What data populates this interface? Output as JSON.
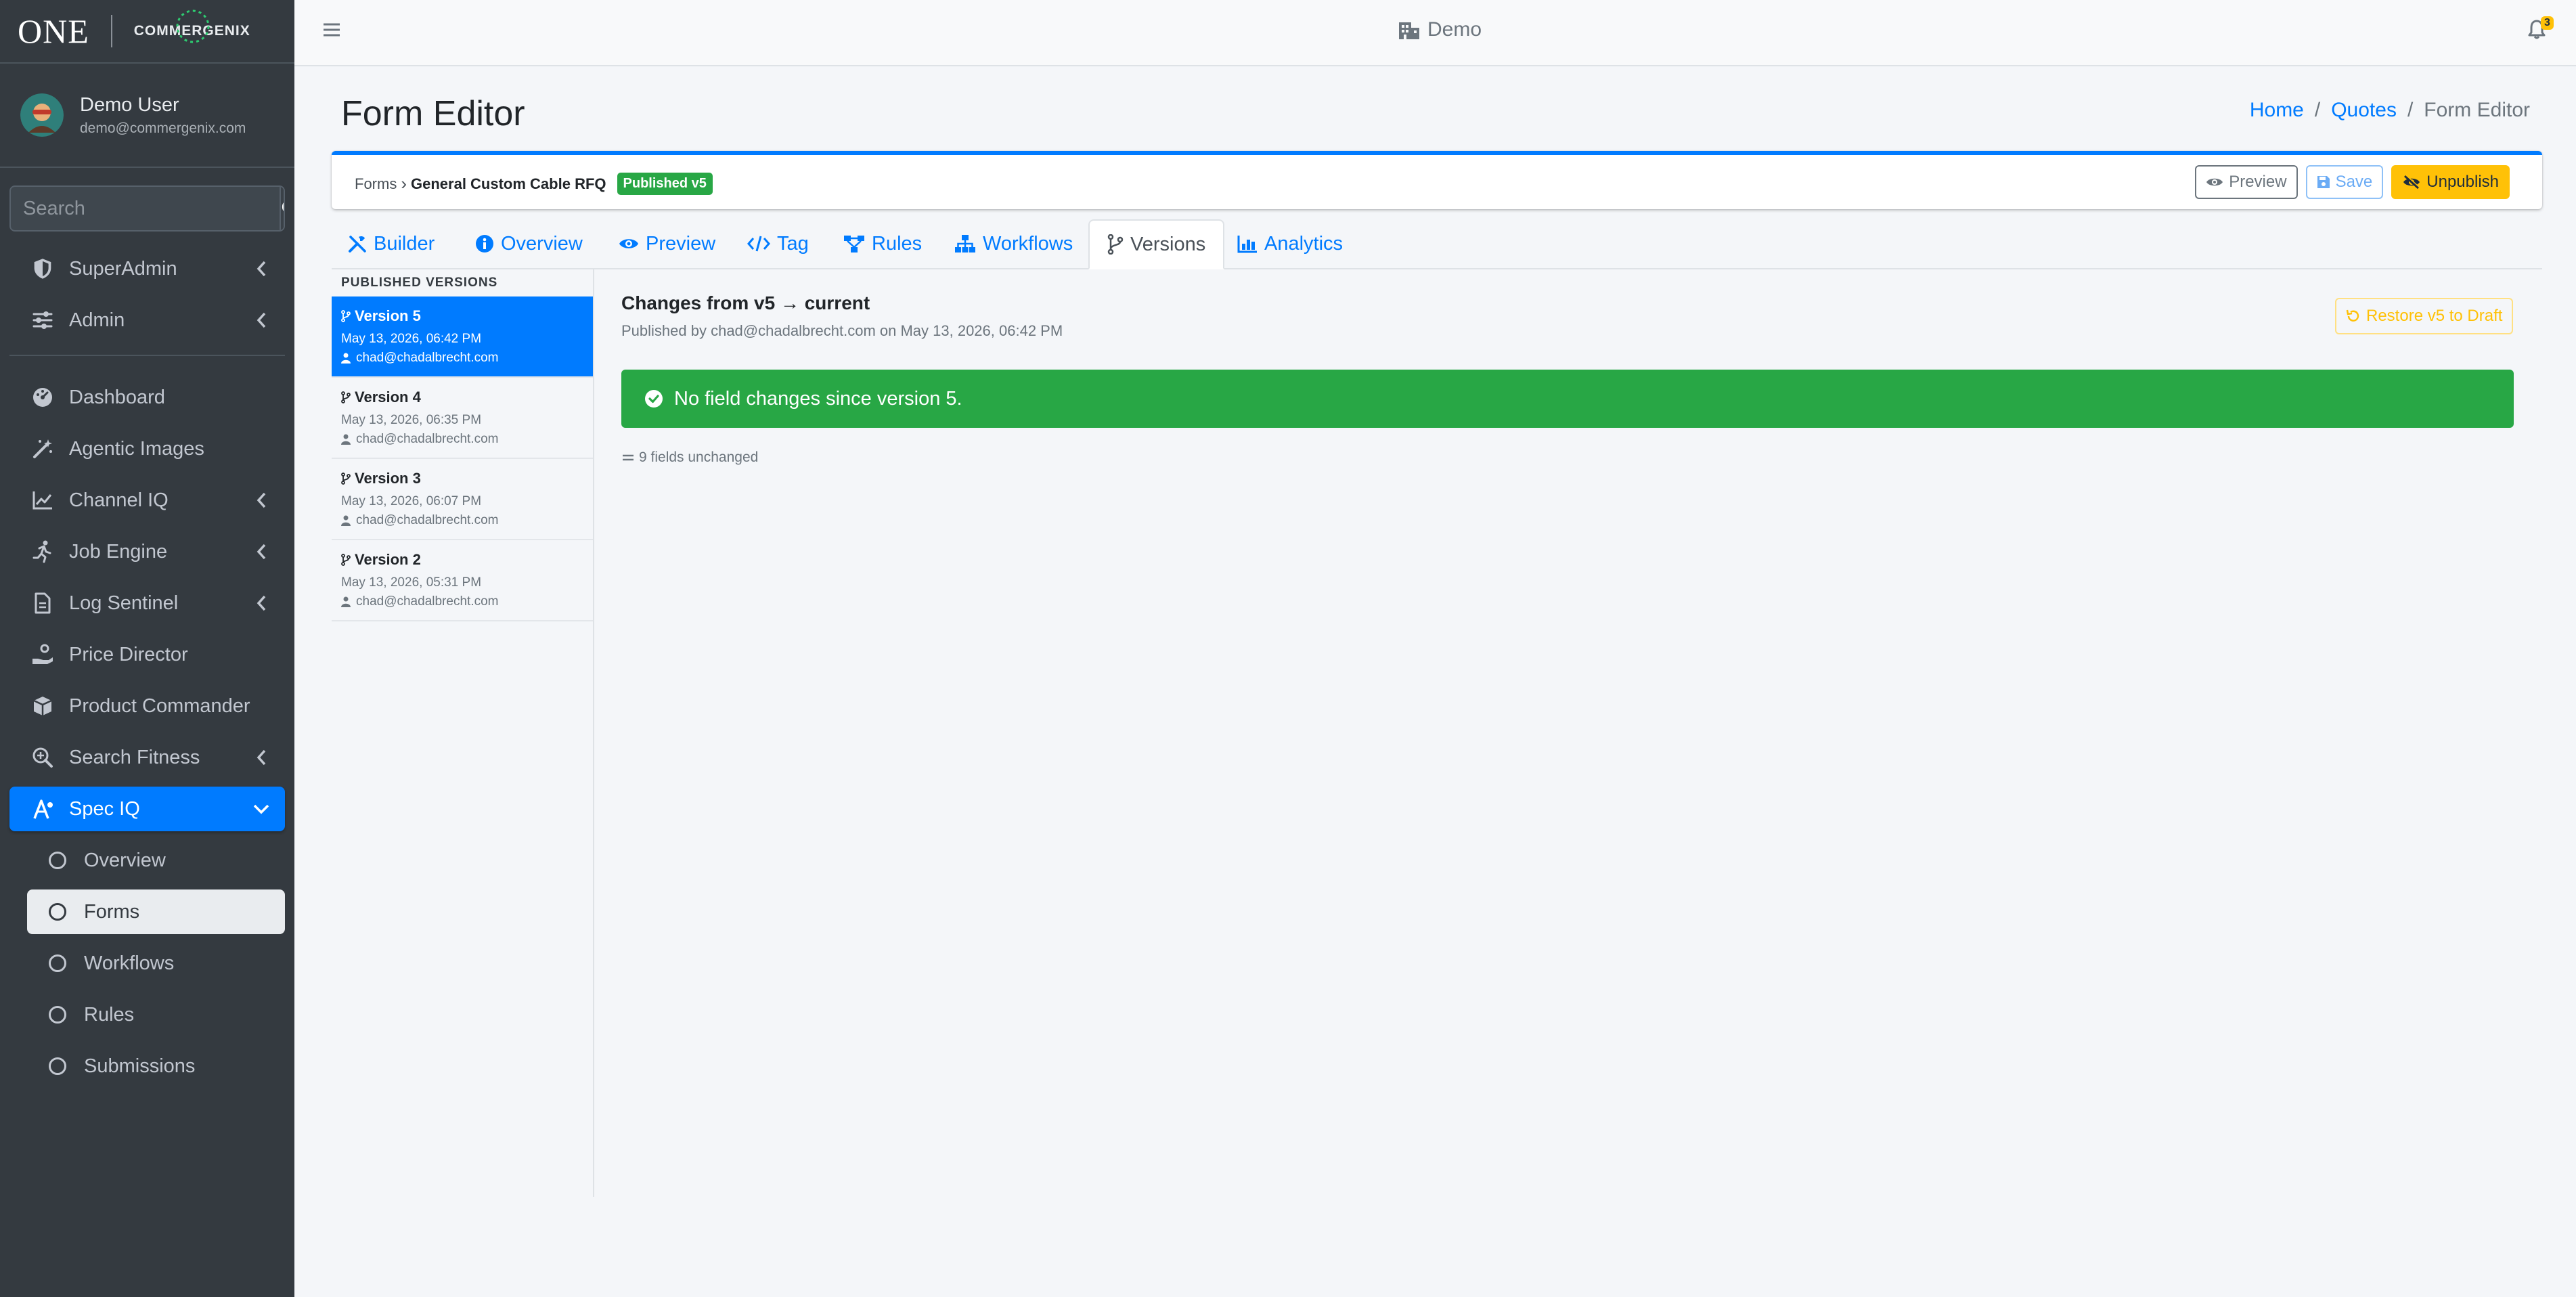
{
  "brand": {
    "one": "ONE",
    "company": "COMMERGENIX"
  },
  "user": {
    "name": "Demo User",
    "email": "demo@commergenix.com"
  },
  "search": {
    "placeholder": "Search"
  },
  "nav": {
    "top_items": [
      {
        "label": "SuperAdmin",
        "icon": "shield-icon",
        "expandable": true
      },
      {
        "label": "Admin",
        "icon": "sliders-icon",
        "expandable": true
      }
    ],
    "items": [
      {
        "label": "Dashboard",
        "icon": "gauge-icon"
      },
      {
        "label": "Agentic Images",
        "icon": "magic-wand-icon"
      },
      {
        "label": "Channel IQ",
        "icon": "chart-line-icon",
        "expandable": true
      },
      {
        "label": "Job Engine",
        "icon": "running-icon",
        "expandable": true
      },
      {
        "label": "Log Sentinel",
        "icon": "file-icon",
        "expandable": true
      },
      {
        "label": "Price Director",
        "icon": "hand-coin-icon"
      },
      {
        "label": "Product Commander",
        "icon": "box-icon"
      },
      {
        "label": "Search Fitness",
        "icon": "search-plus-icon",
        "expandable": true
      },
      {
        "label": "Spec IQ",
        "icon": "spec-icon",
        "expandable": true,
        "active": true
      }
    ],
    "sub_items": [
      {
        "label": "Overview"
      },
      {
        "label": "Forms",
        "active": true
      },
      {
        "label": "Workflows"
      },
      {
        "label": "Rules"
      },
      {
        "label": "Submissions"
      }
    ]
  },
  "topbar": {
    "tenant": "Demo",
    "notification_count": "3"
  },
  "page": {
    "title": "Form Editor",
    "breadcrumb": {
      "home": "Home",
      "quotes": "Quotes",
      "current": "Form Editor"
    }
  },
  "form_header": {
    "crumb_root": "Forms",
    "form_name": "General Custom Cable RFQ",
    "status_badge": "Published v5",
    "preview_label": "Preview",
    "save_label": "Save",
    "unpublish_label": "Unpublish"
  },
  "tabs": [
    {
      "label": "Builder",
      "icon": "tools-icon"
    },
    {
      "label": "Overview",
      "icon": "info-circle-icon"
    },
    {
      "label": "Preview",
      "icon": "eye-icon"
    },
    {
      "label": "Tag",
      "icon": "code-icon"
    },
    {
      "label": "Rules",
      "icon": "rules-icon"
    },
    {
      "label": "Workflows",
      "icon": "sitemap-icon"
    },
    {
      "label": "Versions",
      "icon": "branch-icon",
      "active": true
    },
    {
      "label": "Analytics",
      "icon": "chart-icon"
    }
  ],
  "versions": {
    "header": "PUBLISHED VERSIONS",
    "items": [
      {
        "label": "Version 5",
        "date": "May 13, 2026, 06:42 PM",
        "user": "chad@chadalbrecht.com",
        "active": true
      },
      {
        "label": "Version 4",
        "date": "May 13, 2026, 06:35 PM",
        "user": "chad@chadalbrecht.com"
      },
      {
        "label": "Version 3",
        "date": "May 13, 2026, 06:07 PM",
        "user": "chad@chadalbrecht.com"
      },
      {
        "label": "Version 2",
        "date": "May 13, 2026, 05:31 PM",
        "user": "chad@chadalbrecht.com"
      }
    ]
  },
  "detail": {
    "title": "Changes from v5 → current",
    "subtitle": "Published by chad@chadalbrecht.com on May 13, 2026, 06:42 PM",
    "restore_label": "Restore v5 to Draft",
    "alert": "No field changes since version 5.",
    "unchanged": "9 fields unchanged"
  },
  "colors": {
    "primary": "#007bff",
    "success": "#28a745",
    "warning": "#ffc107",
    "sidebar": "#343a40"
  }
}
